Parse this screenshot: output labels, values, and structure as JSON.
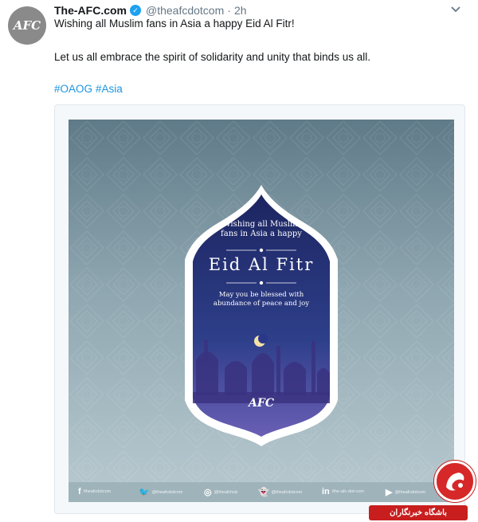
{
  "tweet": {
    "display_name": "The-AFC.com",
    "handle": "@theafcdotcom",
    "dot": "·",
    "time": "2h",
    "avatar_text": "AFC",
    "line1": "Wishing all Muslim fans in Asia a happy Eid Al Fitr!",
    "line2": "Let us all embrace the spirit of solidarity and unity that binds us all.",
    "hashtags": [
      "#OAOG",
      "#Asia"
    ]
  },
  "poster": {
    "wish_line1": "Wishing all Muslim",
    "wish_line2": "fans in Asia a happy",
    "title": "Eid Al Fitr",
    "blessed_line1": "May you be blessed with",
    "blessed_line2": "abundance of peace and joy",
    "logo": "AFC",
    "footer": [
      {
        "icon": "f",
        "label": "/theafcdotcom"
      },
      {
        "icon": "🐦",
        "label": "@theafcdotcom"
      },
      {
        "icon": "◎",
        "label": "@theafchub"
      },
      {
        "icon": "👻",
        "label": "@theafcdotcom"
      },
      {
        "icon": "in",
        "label": "/the-afc-dot-com"
      },
      {
        "icon": "▶",
        "label": "@theafcdotcom"
      }
    ]
  },
  "watermark": {
    "text": "باشگاه خبرنگاران"
  },
  "colors": {
    "hashtag": "#1b95e0",
    "arch": "#1f2a6b",
    "verified": "#1da1f2"
  }
}
